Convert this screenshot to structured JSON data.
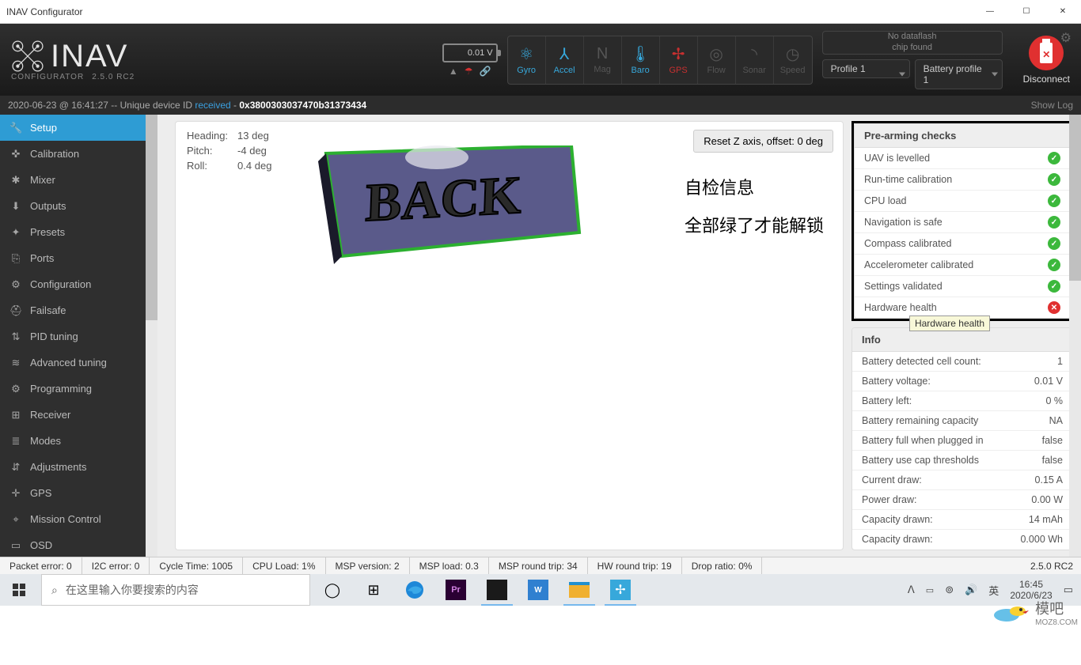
{
  "window_title": "INAV Configurator",
  "brand": {
    "name": "INAV",
    "sub1": "CONFIGURATOR",
    "sub2": "2.5.0 RC2"
  },
  "battery_voltage": "0.01 V",
  "sensors": [
    {
      "label": "Gyro",
      "state": "on",
      "glyph": "⚛"
    },
    {
      "label": "Accel",
      "state": "on",
      "glyph": "⅄"
    },
    {
      "label": "Mag",
      "state": "off",
      "glyph": "N"
    },
    {
      "label": "Baro",
      "state": "on",
      "glyph": "🌡"
    },
    {
      "label": "GPS",
      "state": "warn",
      "glyph": "✢"
    },
    {
      "label": "Flow",
      "state": "off",
      "glyph": "◎"
    },
    {
      "label": "Sonar",
      "state": "off",
      "glyph": "◝"
    },
    {
      "label": "Speed",
      "state": "off",
      "glyph": "◷"
    }
  ],
  "dataflash": "No dataflash\nchip found",
  "profiles": {
    "profile": "Profile 1",
    "battery": "Battery profile 1"
  },
  "disconnect_label": "Disconnect",
  "log": {
    "prefix": "2020-06-23 @ 16:41:27 -- Unique device ID ",
    "received": "received",
    "dash": " - ",
    "id": "0x3800303037470b31373434",
    "showlog": "Show Log"
  },
  "sidebar": [
    {
      "label": "Setup",
      "icon": "🔧",
      "active": true
    },
    {
      "label": "Calibration",
      "icon": "✜"
    },
    {
      "label": "Mixer",
      "icon": "✱"
    },
    {
      "label": "Outputs",
      "icon": "⬇"
    },
    {
      "label": "Presets",
      "icon": "✦"
    },
    {
      "label": "Ports",
      "icon": "⎘"
    },
    {
      "label": "Configuration",
      "icon": "⚙"
    },
    {
      "label": "Failsafe",
      "icon": "⛑"
    },
    {
      "label": "PID tuning",
      "icon": "⇅"
    },
    {
      "label": "Advanced tuning",
      "icon": "≋"
    },
    {
      "label": "Programming",
      "icon": "⚙"
    },
    {
      "label": "Receiver",
      "icon": "⊞"
    },
    {
      "label": "Modes",
      "icon": "≣"
    },
    {
      "label": "Adjustments",
      "icon": "⇵"
    },
    {
      "label": "GPS",
      "icon": "✛"
    },
    {
      "label": "Mission Control",
      "icon": "⌖"
    },
    {
      "label": "OSD",
      "icon": "▭"
    }
  ],
  "orientation": {
    "heading_label": "Heading:",
    "heading": "13 deg",
    "pitch_label": "Pitch:",
    "pitch": "-4 deg",
    "roll_label": "Roll:",
    "roll": "0.4 deg"
  },
  "reset_button": "Reset Z axis, offset: 0 deg",
  "annotation": {
    "line1": "自检信息",
    "line2": "全部绿了才能解锁"
  },
  "prearming": {
    "title": "Pre-arming checks",
    "items": [
      {
        "label": "UAV is levelled",
        "ok": true
      },
      {
        "label": "Run-time calibration",
        "ok": true
      },
      {
        "label": "CPU load",
        "ok": true
      },
      {
        "label": "Navigation is safe",
        "ok": true
      },
      {
        "label": "Compass calibrated",
        "ok": true
      },
      {
        "label": "Accelerometer calibrated",
        "ok": true
      },
      {
        "label": "Settings validated",
        "ok": true
      },
      {
        "label": "Hardware health",
        "ok": false
      }
    ]
  },
  "tooltip": "Hardware health",
  "info": {
    "title": "Info",
    "rows": [
      {
        "label": "Battery detected cell count:",
        "value": "1"
      },
      {
        "label": "Battery voltage:",
        "value": "0.01 V"
      },
      {
        "label": "Battery left:",
        "value": "0 %"
      },
      {
        "label": "Battery remaining capacity",
        "value": "NA"
      },
      {
        "label": "Battery full when plugged in",
        "value": "false"
      },
      {
        "label": "Battery use cap thresholds",
        "value": "false"
      },
      {
        "label": "Current draw:",
        "value": "0.15 A"
      },
      {
        "label": "Power draw:",
        "value": "0.00 W"
      },
      {
        "label": "Capacity drawn:",
        "value": "14 mAh"
      },
      {
        "label": "Capacity drawn:",
        "value": "0.000 Wh"
      }
    ]
  },
  "statusbar": {
    "cells": [
      "Packet error: 0",
      "I2C error: 0",
      "Cycle Time: 1005",
      "CPU Load: 1%",
      "MSP version: 2",
      "MSP load: 0.3",
      "MSP round trip: 34",
      "HW round trip: 19",
      "Drop ratio: 0%"
    ],
    "version": "2.5.0 RC2"
  },
  "taskbar": {
    "search_placeholder": "在这里输入你要搜索的内容",
    "ime": "英",
    "time": "16:45",
    "date": "2020/6/23"
  },
  "watermark": {
    "text": "模吧",
    "url": "MOZ8.COM"
  }
}
